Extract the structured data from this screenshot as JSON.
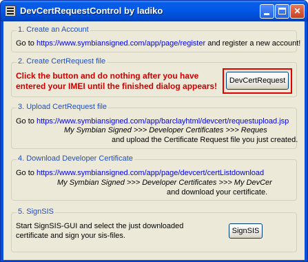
{
  "window": {
    "title": "DevCertRequestControl by ladiko"
  },
  "controls": {
    "minimize": "_",
    "maximize": "□",
    "close": "✕"
  },
  "groups": {
    "create_account": {
      "legend": "1. Create an Account",
      "prefix": "Go to ",
      "url": "https://www.symbiansigned.com/app/page/register",
      "suffix": " and register a new account!"
    },
    "create_request": {
      "legend": "2. Create CertRequest file",
      "warning_line1": "Click the button and do nothing after you have",
      "warning_line2": "entered your IMEI until the finished dialog appears!",
      "button_label": "DevCertRequest"
    },
    "upload_request": {
      "legend": "3. Upload CertRequest file",
      "prefix": "Go to ",
      "url": "https://www.symbiansigned.com/app/barclayhtml/devcert/requestupload.jsp",
      "path": "My Symbian Signed >>> Developer Certificates >>> Reques",
      "instruction": "and upload the Certificate Request file you just created."
    },
    "download_cert": {
      "legend": "4. Download Developer Certificate",
      "prefix": "Go to ",
      "url": "https://www.symbiansigned.com/app/page/devcert/certListdownload",
      "path": "My Symbian Signed >>> Developer Certificates >>> My DevCer",
      "instruction": "and download your certificate."
    },
    "signsis": {
      "legend": "5. SignSIS",
      "text_line1": "Start SignSIS-GUI and select the just downloaded",
      "text_line2": "certificate and sign your sis-files.",
      "button_label": "SignSIS"
    }
  },
  "colors": {
    "title_bar": "#0058e6",
    "legend_text": "#1f4fc0",
    "warning": "#cc0000",
    "highlight": "#e00000"
  }
}
